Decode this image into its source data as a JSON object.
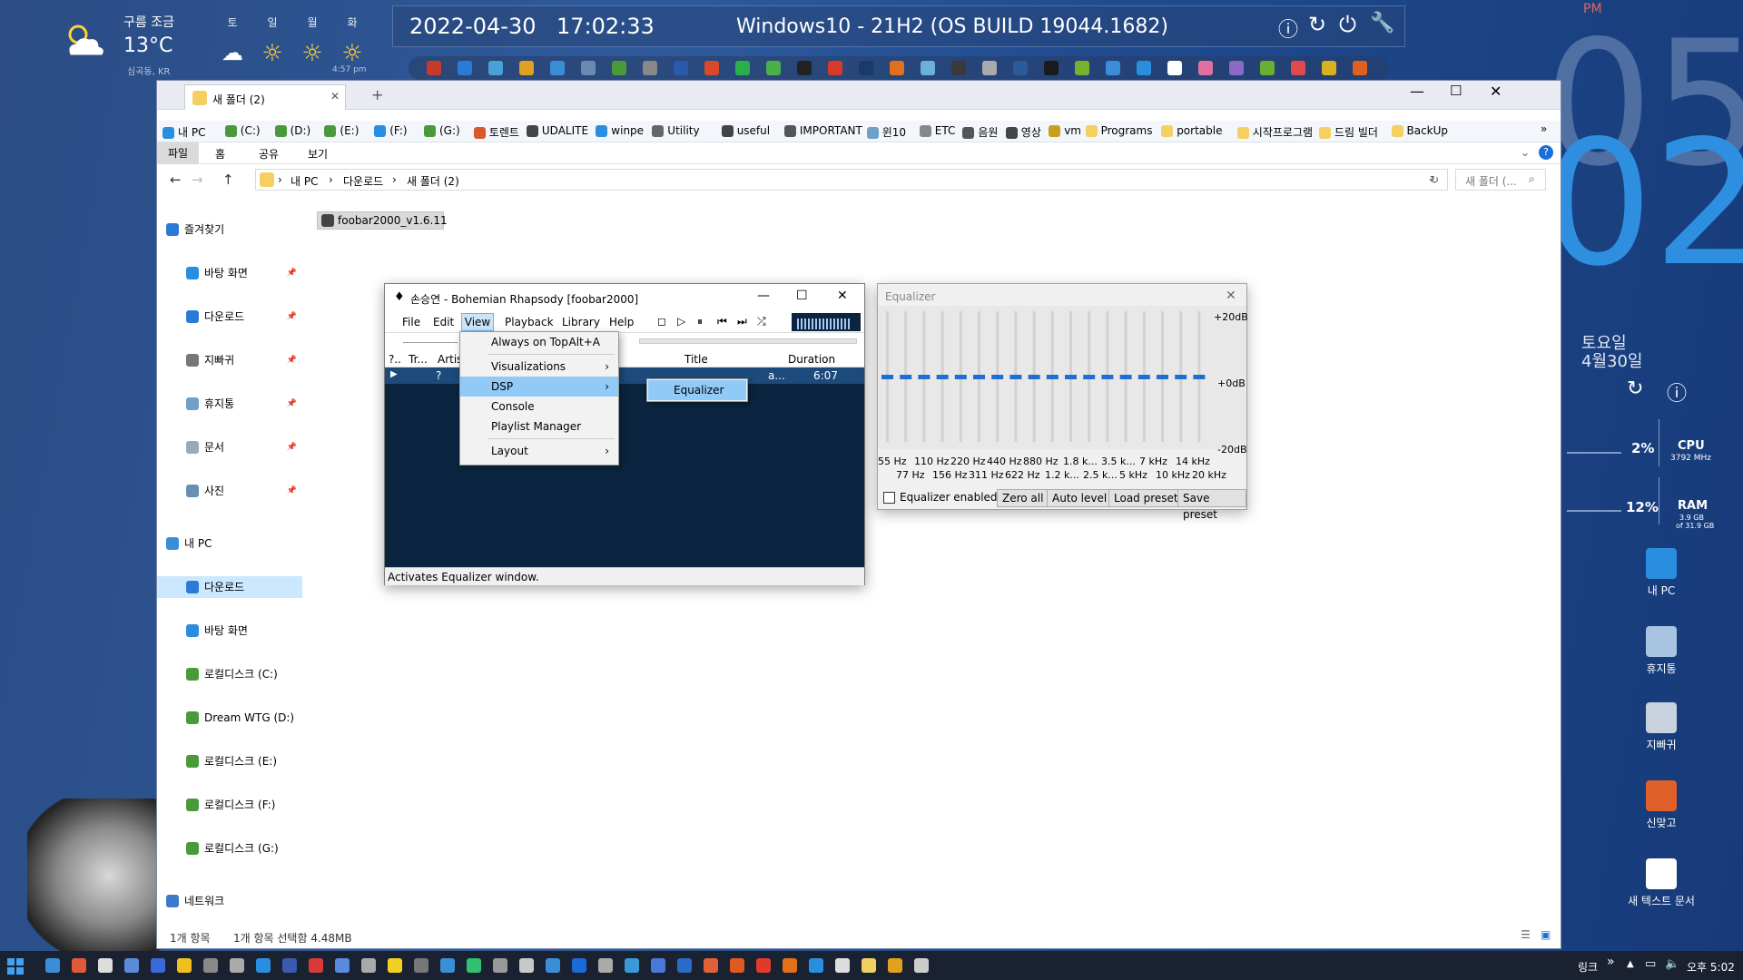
{
  "weather": {
    "condition": "구름 조금",
    "temp": "13°C",
    "location": "심곡동, KR",
    "time": "4:57 pm",
    "days": [
      "토",
      "일",
      "월",
      "화"
    ]
  },
  "topbar": {
    "date": "2022-04-30",
    "time": "17:02:33",
    "os": "Windows10 - 21H2 (OS BUILD 19044.1682)"
  },
  "clock": {
    "ampm": "PM",
    "hour": "05",
    "minute": "02",
    "weekday": "토요일",
    "date": "4월30일"
  },
  "meters": {
    "cpu_pct": "2%",
    "cpu_label": "CPU",
    "cpu_freq": "3792 MHz",
    "ram_pct": "12%",
    "ram_label": "RAM",
    "ram_used": "3.9 GB",
    "ram_total": "of 31.9 GB"
  },
  "desktop_icons": [
    "내 PC",
    "휴지통",
    "지빠귀",
    "신맞고",
    "새 텍스트 문서"
  ],
  "explorer": {
    "tab": "새 폴더 (2)",
    "favorites": [
      "내 PC",
      "(C:)",
      "(D:)",
      "(E:)",
      "(F:)",
      "(G:)",
      "토렌트",
      "UDALITE",
      "winpe",
      "Utility",
      "useful",
      "IMPORTANT",
      "윈10",
      "ETC",
      "음원",
      "영상",
      "vm",
      "Programs",
      "portable",
      "시작프로그램",
      "드림 빌더",
      "BackUp"
    ],
    "ribbon": [
      "파일",
      "홈",
      "공유",
      "보기"
    ],
    "path": [
      "내 PC",
      "다운로드",
      "새 폴더 (2)"
    ],
    "search_placeholder": "새 폴더 (...",
    "nav": [
      {
        "label": "즐겨찾기",
        "indent": 0,
        "color": "#2a7ad8"
      },
      {
        "label": "바탕 화면",
        "indent": 1,
        "color": "#2a8ee0",
        "pin": true
      },
      {
        "label": "다운로드",
        "indent": 1,
        "color": "#2a7ad8",
        "pin": true
      },
      {
        "label": "지빠귀",
        "indent": 1,
        "color": "#777",
        "pin": true
      },
      {
        "label": "휴지통",
        "indent": 1,
        "color": "#6ea0c8",
        "pin": true
      },
      {
        "label": "문서",
        "indent": 1,
        "color": "#9ab",
        "pin": true
      },
      {
        "label": "사진",
        "indent": 1,
        "color": "#6a8fb0",
        "pin": true
      },
      {
        "label": "",
        "indent": 0,
        "spacer": true
      },
      {
        "label": "내 PC",
        "indent": 0,
        "color": "#3a8ed8"
      },
      {
        "label": "다운로드",
        "indent": 1,
        "color": "#2a7ad8",
        "selected": true
      },
      {
        "label": "바탕 화면",
        "indent": 1,
        "color": "#2a8ee0"
      },
      {
        "label": "로컬디스크 (C:)",
        "indent": 1,
        "color": "#4a9a3a"
      },
      {
        "label": "Dream WTG (D:)",
        "indent": 1,
        "color": "#4a9a3a"
      },
      {
        "label": "로컬디스크 (E:)",
        "indent": 1,
        "color": "#4a9a3a"
      },
      {
        "label": "로컬디스크 (F:)",
        "indent": 1,
        "color": "#4a9a3a"
      },
      {
        "label": "로컬디스크 (G:)",
        "indent": 1,
        "color": "#4a9a3a"
      },
      {
        "label": "",
        "indent": 0,
        "spacer": true
      },
      {
        "label": "네트워크",
        "indent": 0,
        "color": "#3a7ac8"
      }
    ],
    "file": "foobar2000_v1.6.11",
    "status_count": "1개 항목",
    "status_sel": "1개 항목 선택함 4.48MB"
  },
  "foobar": {
    "title": "손승연 - Bohemian Rhapsody  [foobar2000]",
    "menu": [
      "File",
      "Edit",
      "View",
      "Playback",
      "Library",
      "Help"
    ],
    "cols": [
      "?..",
      "Tr...",
      "Artis",
      "Title",
      "Duration"
    ],
    "row": {
      "play": "▶",
      "track": "?",
      "dur": "6:07",
      "extra": "a..."
    },
    "status": "Activates Equalizer window.",
    "view_menu": [
      {
        "label": "Always on Top",
        "sc": "Alt+A"
      },
      {
        "sep": true
      },
      {
        "label": "Visualizations",
        "sub": true
      },
      {
        "label": "DSP",
        "sub": true,
        "sel": true
      },
      {
        "label": "Console"
      },
      {
        "label": "Playlist Manager"
      },
      {
        "sep": true
      },
      {
        "label": "Layout",
        "sub": true
      }
    ],
    "submenu": "Equalizer"
  },
  "eq": {
    "title": "Equalizer",
    "db_labels": [
      "+20dB",
      "+0dB",
      "-20dB"
    ],
    "bands_top": [
      "55 Hz",
      "110 Hz",
      "220 Hz",
      "440 Hz",
      "880 Hz",
      "1.8 k...",
      "3.5 k...",
      "7 kHz",
      "14 kHz"
    ],
    "bands_bot": [
      "77 Hz",
      "156 Hz",
      "311 Hz",
      "622 Hz",
      "1.2 k...",
      "2.5 k...",
      "5 kHz",
      "10 kHz",
      "20 kHz"
    ],
    "bands_levels_db": [
      0,
      0,
      0,
      0,
      0,
      0,
      0,
      0,
      0,
      0,
      0,
      0,
      0,
      0,
      0,
      0,
      0,
      0
    ],
    "enabled_label": "Equalizer enabled",
    "buttons": [
      "Zero all",
      "Auto level",
      "Load preset",
      "Save preset"
    ]
  },
  "taskbar": {
    "link": "링크",
    "clock": "오후 5:02"
  }
}
